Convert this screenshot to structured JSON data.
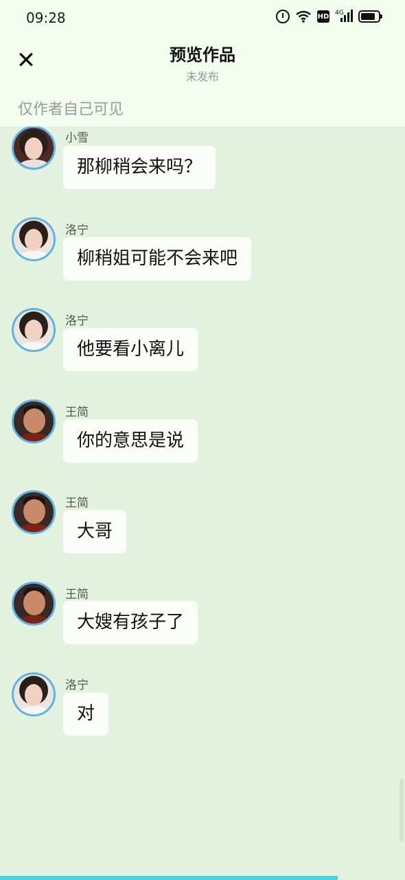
{
  "status_bar": {
    "time": "09:28",
    "icons": [
      "alarm-icon",
      "wifi-icon",
      "hd-icon",
      "signal-4g-icon",
      "battery-icon"
    ],
    "hd_label": "HD",
    "network_label": "4G"
  },
  "header": {
    "close_icon": "close-icon",
    "title": "预览作品",
    "subtitle": "未发布"
  },
  "visibility_note": "仅作者自己可见",
  "messages": [
    {
      "sender": "小雪",
      "text": "那柳稍会来吗？",
      "avatar": "avatar-xiaoxue"
    },
    {
      "sender": "洛宁",
      "text": "柳稍姐可能不会来吧",
      "avatar": "avatar-luoning"
    },
    {
      "sender": "洛宁",
      "text": "他要看小离儿",
      "avatar": "avatar-luoning"
    },
    {
      "sender": "王简",
      "text": "你的意思是说",
      "avatar": "avatar-wangjian"
    },
    {
      "sender": "王简",
      "text": "大哥",
      "avatar": "avatar-wangjian"
    },
    {
      "sender": "王简",
      "text": "大嫂有孩子了",
      "avatar": "avatar-wangjian"
    },
    {
      "sender": "洛宁",
      "text": "对",
      "avatar": "avatar-luoning"
    }
  ],
  "colors": {
    "header_bg": "#f2fdf0",
    "chat_bg": "#e3f2de",
    "bubble_bg": "#fafdf8",
    "avatar_ring": "#5fb2e8",
    "progress_bar": "#4dd0e1"
  }
}
